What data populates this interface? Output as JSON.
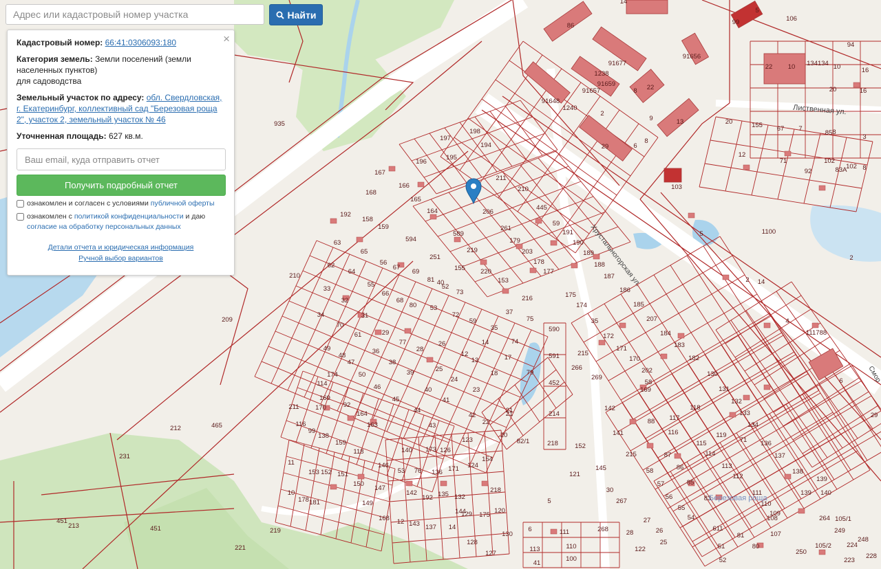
{
  "search": {
    "placeholder": "Адрес или кадастровый номер участка",
    "button_label": "Найти",
    "button_icon": "search-icon"
  },
  "panel": {
    "cadastral_label": "Кадастровый номер:",
    "cadastral_number": "66:41:0306093:180",
    "category_label": "Категория земель:",
    "category_value": "Земли поселений (земли населенных пунктов)",
    "category_use": "для садоводства",
    "address_label": "Земельный участок по адресу:",
    "address_value": "обл. Свердловская, г. Екатеринбург, коллективный сад \"Березовая роща 2\", участок 2, земельный участок № 46",
    "area_label": "Уточненная площадь:",
    "area_value": "627 кв.м.",
    "email_placeholder": "Ваш email, куда отправить отчет",
    "report_button": "Получить подробный отчет",
    "check1_prefix": "ознакомлен и согласен с условиями",
    "check1_link": "публичной оферты",
    "check2_prefix": "ознакомлен с",
    "check2_link": "политикой конфиденциальности",
    "check2_mid": "и даю",
    "check2_link2": "согласие на обработку персональных данных",
    "details_link": "Детали отчета и юридическая информация",
    "manual_link": "Ручной выбор вариантов",
    "close_label": "×"
  },
  "map": {
    "colors": {
      "background": "#f2efe9",
      "green": "#cfe5bd",
      "water": "#aad3ec",
      "boundary": "#b02828",
      "building": "#d97a7a",
      "road": "#ffffff",
      "marker": "#2a7fc4"
    },
    "street_labels": [
      {
        "id": "listvennaya",
        "text": "Лиственная ул."
      },
      {
        "id": "khrustalnogorskaya",
        "text": "Хрустальногорская ул."
      },
      {
        "id": "berezovaya",
        "text": "Березовая роща"
      },
      {
        "id": "smor",
        "text": "Смор"
      }
    ],
    "plot_labels": [
      {
        "t": "935"
      },
      {
        "t": "209"
      },
      {
        "t": "210"
      },
      {
        "t": "212"
      },
      {
        "t": "465"
      },
      {
        "t": "231"
      },
      {
        "t": "451"
      },
      {
        "t": "213"
      },
      {
        "t": "451"
      },
      {
        "t": "221"
      },
      {
        "t": "219"
      },
      {
        "t": "197"
      },
      {
        "t": "198"
      },
      {
        "t": "194"
      },
      {
        "t": "196"
      },
      {
        "t": "195"
      },
      {
        "t": "211"
      },
      {
        "t": "210"
      },
      {
        "t": "167"
      },
      {
        "t": "168"
      },
      {
        "t": "166"
      },
      {
        "t": "165"
      },
      {
        "t": "164"
      },
      {
        "t": "192"
      },
      {
        "t": "158"
      },
      {
        "t": "159"
      },
      {
        "t": "594"
      },
      {
        "t": "206"
      },
      {
        "t": "261"
      },
      {
        "t": "445"
      },
      {
        "t": "59"
      },
      {
        "t": "191"
      },
      {
        "t": "190"
      },
      {
        "t": "189"
      },
      {
        "t": "188"
      },
      {
        "t": "187"
      },
      {
        "t": "179"
      },
      {
        "t": "203"
      },
      {
        "t": "178"
      },
      {
        "t": "177"
      },
      {
        "t": "175"
      },
      {
        "t": "174"
      },
      {
        "t": "216"
      },
      {
        "t": "153"
      },
      {
        "t": "220"
      },
      {
        "t": "155"
      },
      {
        "t": "219"
      },
      {
        "t": "251"
      },
      {
        "t": "589"
      },
      {
        "t": "63"
      },
      {
        "t": "65"
      },
      {
        "t": "56"
      },
      {
        "t": "67"
      },
      {
        "t": "62"
      },
      {
        "t": "64"
      },
      {
        "t": "69"
      },
      {
        "t": "81"
      },
      {
        "t": "52"
      },
      {
        "t": "73"
      },
      {
        "t": "37"
      },
      {
        "t": "75"
      },
      {
        "t": "74"
      },
      {
        "t": "33"
      },
      {
        "t": "32"
      },
      {
        "t": "55"
      },
      {
        "t": "66"
      },
      {
        "t": "68"
      },
      {
        "t": "80"
      },
      {
        "t": "53"
      },
      {
        "t": "72"
      },
      {
        "t": "59"
      },
      {
        "t": "35"
      },
      {
        "t": "34"
      },
      {
        "t": "31"
      },
      {
        "t": "29"
      },
      {
        "t": "70"
      },
      {
        "t": "61"
      },
      {
        "t": "36"
      },
      {
        "t": "77"
      },
      {
        "t": "28"
      },
      {
        "t": "26"
      },
      {
        "t": "12"
      },
      {
        "t": "14"
      },
      {
        "t": "17"
      },
      {
        "t": "13"
      },
      {
        "t": "18"
      },
      {
        "t": "49"
      },
      {
        "t": "48"
      },
      {
        "t": "47"
      },
      {
        "t": "38"
      },
      {
        "t": "39"
      },
      {
        "t": "25"
      },
      {
        "t": "24"
      },
      {
        "t": "23"
      },
      {
        "t": "50"
      },
      {
        "t": "46"
      },
      {
        "t": "45"
      },
      {
        "t": "44"
      },
      {
        "t": "41"
      },
      {
        "t": "40"
      },
      {
        "t": "174"
      },
      {
        "t": "114"
      },
      {
        "t": "169"
      },
      {
        "t": "170"
      },
      {
        "t": "92"
      },
      {
        "t": "164"
      },
      {
        "t": "163"
      },
      {
        "t": "21"
      },
      {
        "t": "43"
      },
      {
        "t": "42"
      },
      {
        "t": "22"
      },
      {
        "t": "20"
      },
      {
        "t": "21"
      },
      {
        "t": "82/1"
      },
      {
        "t": "79"
      },
      {
        "t": "590"
      },
      {
        "t": "591"
      },
      {
        "t": "452"
      },
      {
        "t": "214"
      },
      {
        "t": "218"
      },
      {
        "t": "211"
      },
      {
        "t": "116"
      },
      {
        "t": "99"
      },
      {
        "t": "138"
      },
      {
        "t": "159"
      },
      {
        "t": "118"
      },
      {
        "t": "11"
      },
      {
        "t": "153"
      },
      {
        "t": "152"
      },
      {
        "t": "151"
      },
      {
        "t": "150"
      },
      {
        "t": "10"
      },
      {
        "t": "178"
      },
      {
        "t": "181"
      },
      {
        "t": "149"
      },
      {
        "t": "146"
      },
      {
        "t": "147"
      },
      {
        "t": "140"
      },
      {
        "t": "53"
      },
      {
        "t": "76"
      },
      {
        "t": "173"
      },
      {
        "t": "126"
      },
      {
        "t": "136"
      },
      {
        "t": "171"
      },
      {
        "t": "123"
      },
      {
        "t": "124"
      },
      {
        "t": "154"
      },
      {
        "t": "142"
      },
      {
        "t": "192"
      },
      {
        "t": "135"
      },
      {
        "t": "132"
      },
      {
        "t": "218"
      },
      {
        "t": "168"
      },
      {
        "t": "144"
      },
      {
        "t": "12"
      },
      {
        "t": "143"
      },
      {
        "t": "137"
      },
      {
        "t": "14"
      },
      {
        "t": "129"
      },
      {
        "t": "175"
      },
      {
        "t": "120"
      },
      {
        "t": "128"
      },
      {
        "t": "127"
      },
      {
        "t": "130"
      },
      {
        "t": "5"
      },
      {
        "t": "6"
      },
      {
        "t": "113"
      },
      {
        "t": "111"
      },
      {
        "t": "110"
      },
      {
        "t": "100"
      },
      {
        "t": "41"
      },
      {
        "t": "268"
      },
      {
        "t": "35"
      },
      {
        "t": "172"
      },
      {
        "t": "171"
      },
      {
        "t": "170"
      },
      {
        "t": "169"
      },
      {
        "t": "186"
      },
      {
        "t": "185"
      },
      {
        "t": "207"
      },
      {
        "t": "184"
      },
      {
        "t": "183"
      },
      {
        "t": "182"
      },
      {
        "t": "202"
      },
      {
        "t": "58"
      },
      {
        "t": "215"
      },
      {
        "t": "266"
      },
      {
        "t": "269"
      },
      {
        "t": "142"
      },
      {
        "t": "152"
      },
      {
        "t": "121"
      },
      {
        "t": "145"
      },
      {
        "t": "30"
      },
      {
        "t": "267"
      },
      {
        "t": "141"
      },
      {
        "t": "215"
      },
      {
        "t": "88"
      },
      {
        "t": "117"
      },
      {
        "t": "118"
      },
      {
        "t": "130"
      },
      {
        "t": "131"
      },
      {
        "t": "132"
      },
      {
        "t": "133"
      },
      {
        "t": "134"
      },
      {
        "t": "136"
      },
      {
        "t": "137"
      },
      {
        "t": "138"
      },
      {
        "t": "139"
      },
      {
        "t": "139"
      },
      {
        "t": "140"
      },
      {
        "t": "116"
      },
      {
        "t": "115"
      },
      {
        "t": "119"
      },
      {
        "t": "87"
      },
      {
        "t": "58"
      },
      {
        "t": "86"
      },
      {
        "t": "114"
      },
      {
        "t": "113"
      },
      {
        "t": "112"
      },
      {
        "t": "71"
      },
      {
        "t": "57"
      },
      {
        "t": "85"
      },
      {
        "t": "56"
      },
      {
        "t": "55"
      },
      {
        "t": "54"
      },
      {
        "t": "83"
      },
      {
        "t": "111"
      },
      {
        "t": "110"
      },
      {
        "t": "109"
      },
      {
        "t": "108"
      },
      {
        "t": "107"
      },
      {
        "t": "27"
      },
      {
        "t": "28"
      },
      {
        "t": "26"
      },
      {
        "t": "25"
      },
      {
        "t": "122"
      },
      {
        "t": "611"
      },
      {
        "t": "81"
      },
      {
        "t": "51"
      },
      {
        "t": "52"
      },
      {
        "t": "80"
      },
      {
        "t": "250"
      },
      {
        "t": "105/2"
      },
      {
        "t": "249"
      },
      {
        "t": "264"
      },
      {
        "t": "224"
      },
      {
        "t": "248"
      },
      {
        "t": "228"
      },
      {
        "t": "105/1"
      },
      {
        "t": "223"
      },
      {
        "t": "86"
      },
      {
        "t": "1238"
      },
      {
        "t": "91677"
      },
      {
        "t": "91656"
      },
      {
        "t": "8"
      },
      {
        "t": "22"
      },
      {
        "t": "91659"
      },
      {
        "t": "91657"
      },
      {
        "t": "91648"
      },
      {
        "t": "1240"
      },
      {
        "t": "2"
      },
      {
        "t": "9"
      },
      {
        "t": "13"
      },
      {
        "t": "8"
      },
      {
        "t": "6"
      },
      {
        "t": "29"
      },
      {
        "t": "14"
      },
      {
        "t": "5"
      },
      {
        "t": "106"
      },
      {
        "t": "99"
      },
      {
        "t": "94"
      },
      {
        "t": "22"
      },
      {
        "t": "10"
      },
      {
        "t": "134134"
      },
      {
        "t": "10"
      },
      {
        "t": "16"
      },
      {
        "t": "20"
      },
      {
        "t": "16"
      },
      {
        "t": "20"
      },
      {
        "t": "155"
      },
      {
        "t": "67"
      },
      {
        "t": "7"
      },
      {
        "t": "85"
      },
      {
        "t": "8"
      },
      {
        "t": "3"
      },
      {
        "t": "12"
      },
      {
        "t": "71"
      },
      {
        "t": "92"
      },
      {
        "t": "102"
      },
      {
        "t": "83A"
      },
      {
        "t": "102"
      },
      {
        "t": "8"
      },
      {
        "t": "103"
      },
      {
        "t": "5"
      },
      {
        "t": "1100"
      },
      {
        "t": "2"
      },
      {
        "t": "2"
      },
      {
        "t": "14"
      },
      {
        "t": "4"
      },
      {
        "t": "111788"
      },
      {
        "t": "6"
      },
      {
        "t": "29"
      },
      {
        "t": "40"
      }
    ]
  }
}
